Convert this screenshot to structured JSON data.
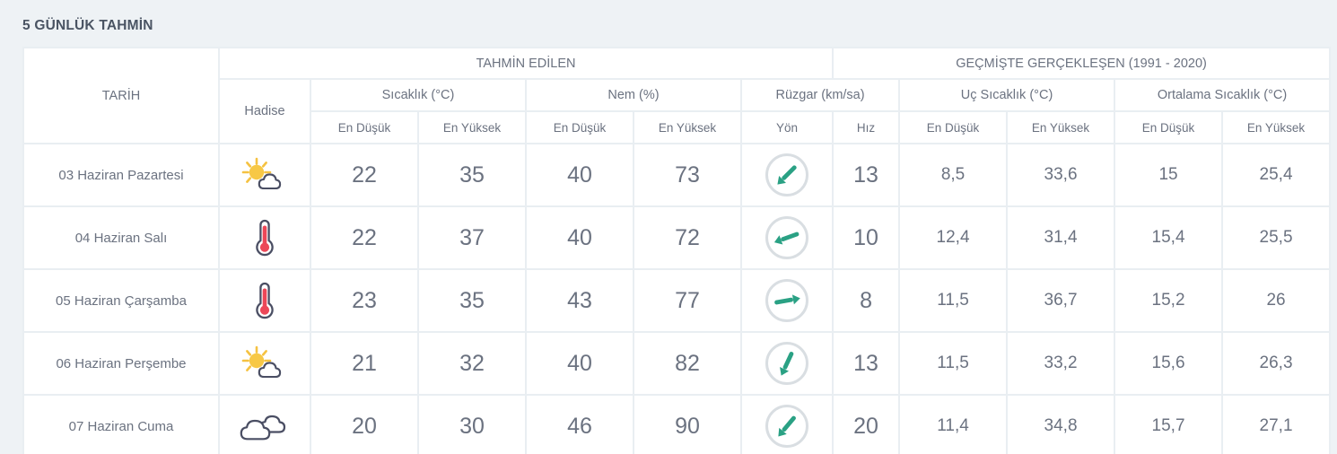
{
  "title": "5 GÜNLÜK TAHMİN",
  "header": {
    "date_col": "TARİH",
    "hadise_col": "Hadise",
    "group_forecast": "TAHMİN EDİLEN",
    "group_history": "GEÇMİŞTE GERÇEKLEŞEN (1991 - 2020)",
    "sub_temp": "Sıcaklık (°C)",
    "sub_humidity": "Nem (%)",
    "sub_wind": "Rüzgar (km/sa)",
    "sub_extreme_temp": "Uç Sıcaklık (°C)",
    "sub_avg_temp": "Ortalama Sıcaklık (°C)",
    "leaf_temp_low": "En Düşük",
    "leaf_temp_high": "En Yüksek",
    "leaf_hum_low": "En Düşük",
    "leaf_hum_high": "En Yüksek",
    "leaf_wind_dir": "Yön",
    "leaf_wind_speed": "Hız",
    "leaf_ext_low": "En Düşük",
    "leaf_ext_high": "En Yüksek",
    "leaf_avg_low": "En Düşük",
    "leaf_avg_high": "En Yüksek"
  },
  "colors": {
    "temp_low": "#3b92ad",
    "temp_high": "#e05a6e",
    "hum_low": "#e0a83c",
    "hum_high": "#8183b4",
    "wind_speed": "#3aa58c",
    "history": "#3c4450",
    "page_bg": "#eef2f5",
    "title": "#4a5463"
  },
  "rows": [
    {
      "date": "03 Haziran Pazartesi",
      "icon": "sun-behind-cloud-icon",
      "temp_low": "22",
      "temp_high": "35",
      "hum_low": "40",
      "hum_high": "73",
      "wind_dir_icon": "arrow-southwest-icon",
      "wind_dir_deg": 225,
      "wind_speed": "13",
      "ext_low": "8,5",
      "ext_high": "33,6",
      "avg_low": "15",
      "avg_high": "25,4"
    },
    {
      "date": "04 Haziran Salı",
      "icon": "thermometer-icon",
      "temp_low": "22",
      "temp_high": "37",
      "hum_low": "40",
      "hum_high": "72",
      "wind_dir_icon": "arrow-west-southwest-icon",
      "wind_dir_deg": 250,
      "wind_speed": "10",
      "ext_low": "12,4",
      "ext_high": "31,4",
      "avg_low": "15,4",
      "avg_high": "25,5"
    },
    {
      "date": "05 Haziran Çarşamba",
      "icon": "thermometer-icon",
      "temp_low": "23",
      "temp_high": "35",
      "hum_low": "43",
      "hum_high": "77",
      "wind_dir_icon": "arrow-east-icon",
      "wind_dir_deg": 80,
      "wind_speed": "8",
      "ext_low": "11,5",
      "ext_high": "36,7",
      "avg_low": "15,2",
      "avg_high": "26"
    },
    {
      "date": "06 Haziran Perşembe",
      "icon": "sun-behind-cloud-icon",
      "temp_low": "21",
      "temp_high": "32",
      "hum_low": "40",
      "hum_high": "82",
      "wind_dir_icon": "arrow-south-southwest-icon",
      "wind_dir_deg": 205,
      "wind_speed": "13",
      "ext_low": "11,5",
      "ext_high": "33,2",
      "avg_low": "15,6",
      "avg_high": "26,3"
    },
    {
      "date": "07 Haziran Cuma",
      "icon": "cloudy-icon",
      "temp_low": "20",
      "temp_high": "30",
      "hum_low": "46",
      "hum_high": "90",
      "wind_dir_icon": "arrow-southwest-icon",
      "wind_dir_deg": 220,
      "wind_speed": "20",
      "ext_low": "11,4",
      "ext_high": "34,8",
      "avg_low": "15,7",
      "avg_high": "27,1"
    }
  ]
}
